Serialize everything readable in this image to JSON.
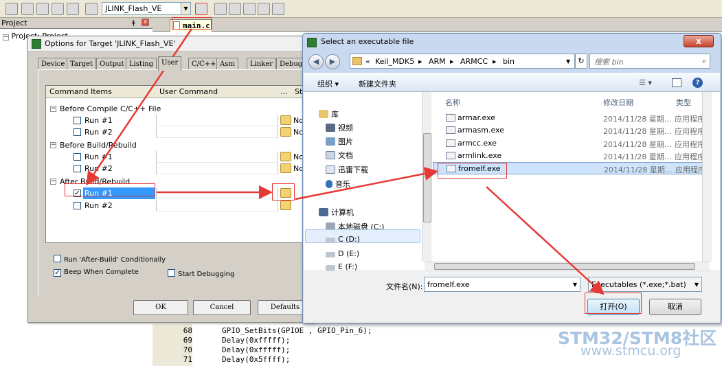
{
  "toolbar": {
    "target_name": "JLINK_Flash_VE"
  },
  "project_panel": {
    "title": "Project",
    "root_label": "Project: Project"
  },
  "editor": {
    "active_tab": "main.c",
    "lines": [
      {
        "num": "68",
        "code": "GPIO_SetBits(GPIOE , GPIO_Pin_6);"
      },
      {
        "num": "69",
        "code": "Delay(0xfffff);"
      },
      {
        "num": "70",
        "code": "Delay(0xfffff);"
      },
      {
        "num": "71",
        "code": "Delay(0x5ffff);"
      }
    ]
  },
  "options_dialog": {
    "title": "Options for Target 'JLINK_Flash_VE'",
    "tabs": [
      "Device",
      "Target",
      "Output",
      "Listing",
      "User",
      "C/C++",
      "Asm",
      "Linker",
      "Debug"
    ],
    "active_tab": "User",
    "columns": {
      "command_items": "Command Items",
      "user_command": "User Command",
      "browse": "...",
      "status": "St"
    },
    "groups": [
      {
        "label": "Before Compile C/C++ File",
        "runs": [
          {
            "label": "Run #1",
            "status": "No"
          },
          {
            "label": "Run #2",
            "status": "No"
          }
        ]
      },
      {
        "label": "Before Build/Rebuild",
        "runs": [
          {
            "label": "Run #1",
            "status": "No"
          },
          {
            "label": "Run #2",
            "status": "No"
          }
        ]
      },
      {
        "label": "After Build/Rebuild",
        "runs": [
          {
            "label": "Run #1",
            "status": ""
          },
          {
            "label": "Run #2",
            "status": ""
          }
        ]
      }
    ],
    "expander_symbol": "−",
    "check_mark": "✓",
    "options": {
      "run_after_build": "Run 'After-Build' Conditionally",
      "beep_when_complete": "Beep When Complete",
      "start_debugging": "Start Debugging"
    },
    "buttons": {
      "ok": "OK",
      "cancel": "Cancel",
      "defaults": "Defaults"
    }
  },
  "file_dialog": {
    "title": "Select an executable file",
    "close_symbol": "x",
    "breadcrumb": [
      "«",
      "Keil_MDK5",
      "ARM",
      "ARMCC",
      "bin"
    ],
    "search_placeholder": "搜索 bin",
    "commands": {
      "organize": "组织 ▾",
      "new_folder": "新建文件夹"
    },
    "nav_items": [
      "库",
      "视频",
      "图片",
      "文档",
      "迅雷下载",
      "音乐",
      "计算机",
      "本地磁盘 (C:)",
      "C (D:)",
      "D (E:)",
      "E (F:)"
    ],
    "columns": {
      "name": "名称",
      "date": "修改日期",
      "type": "类型"
    },
    "files": [
      {
        "name": "armar.exe",
        "date": "2014/11/28 星期...",
        "type": "应用程序"
      },
      {
        "name": "armasm.exe",
        "date": "2014/11/28 星期...",
        "type": "应用程序"
      },
      {
        "name": "armcc.exe",
        "date": "2014/11/28 星期...",
        "type": "应用程序"
      },
      {
        "name": "armlink.exe",
        "date": "2014/11/28 星期...",
        "type": "应用程序"
      },
      {
        "name": "fromelf.exe",
        "date": "2014/11/28 星期...",
        "type": "应用程序"
      }
    ],
    "filename_label": "文件名(N):",
    "filename_value": "fromelf.exe",
    "filetype_value": "Executables (*.exe;*.bat)",
    "buttons": {
      "open": "打开(O)",
      "cancel": "取消"
    }
  },
  "watermark": {
    "brand_a": "STM32/STM8",
    "brand_b": "社区",
    "url": "www.stmcu.org"
  },
  "colors": {
    "selection": "#3399ff",
    "annotation": "#e53935",
    "watermark": "#a8c4e0"
  }
}
